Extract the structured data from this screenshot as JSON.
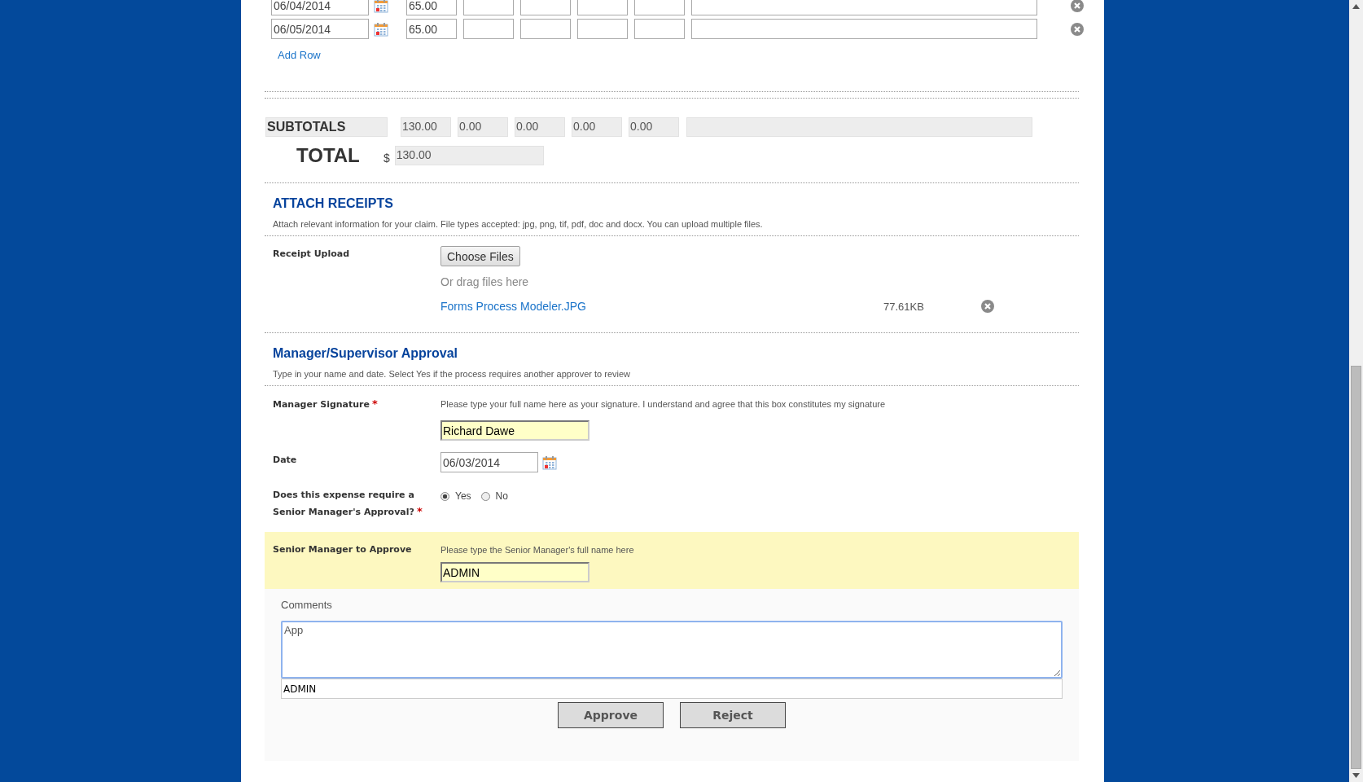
{
  "expense_rows": [
    {
      "date": "06/04/2014",
      "amount": "65.00"
    },
    {
      "date": "06/05/2014",
      "amount": "65.00"
    }
  ],
  "add_row": "Add Row",
  "subtotals": {
    "label": "SUBTOTALS",
    "values": [
      "130.00",
      "0.00",
      "0.00",
      "0.00",
      "0.00"
    ]
  },
  "total": {
    "label": "TOTAL",
    "currency": "$",
    "value": "130.00"
  },
  "attach": {
    "heading": "ATTACH RECEIPTS",
    "description": "Attach relevant information for your claim. File types accepted: jpg, png, tif, pdf, doc and docx. You can upload multiple files.",
    "upload_label": "Receipt Upload",
    "button": "Choose Files",
    "drop_hint": "Or drag files here",
    "files": [
      {
        "name": "Forms Process Modeler.JPG",
        "size": "77.61KB"
      }
    ]
  },
  "approval": {
    "heading": "Manager/Supervisor Approval",
    "description": "Type in your name and date. Select Yes if the process requires another approver to review",
    "signature": {
      "label": "Manager Signature",
      "required_mark": "*",
      "hint": "Please type your full name here as your signature. I understand and agree that this box constitutes my signature",
      "value": "Richard Dawe"
    },
    "date": {
      "label": "Date",
      "value": "06/03/2014"
    },
    "question": {
      "label": "Does this expense require a Senior Manager's Approval?",
      "required_mark": "*",
      "options": [
        {
          "label": "Yes",
          "selected": true
        },
        {
          "label": "No",
          "selected": false
        }
      ]
    },
    "senior": {
      "label": "Senior Manager to Approve",
      "hint": "Please type the Senior Manager's full name here",
      "value": "ADMIN"
    }
  },
  "comments": {
    "label": "Comments",
    "value": "App",
    "author": "ADMIN"
  },
  "buttons": [
    "Approve",
    "Reject"
  ]
}
